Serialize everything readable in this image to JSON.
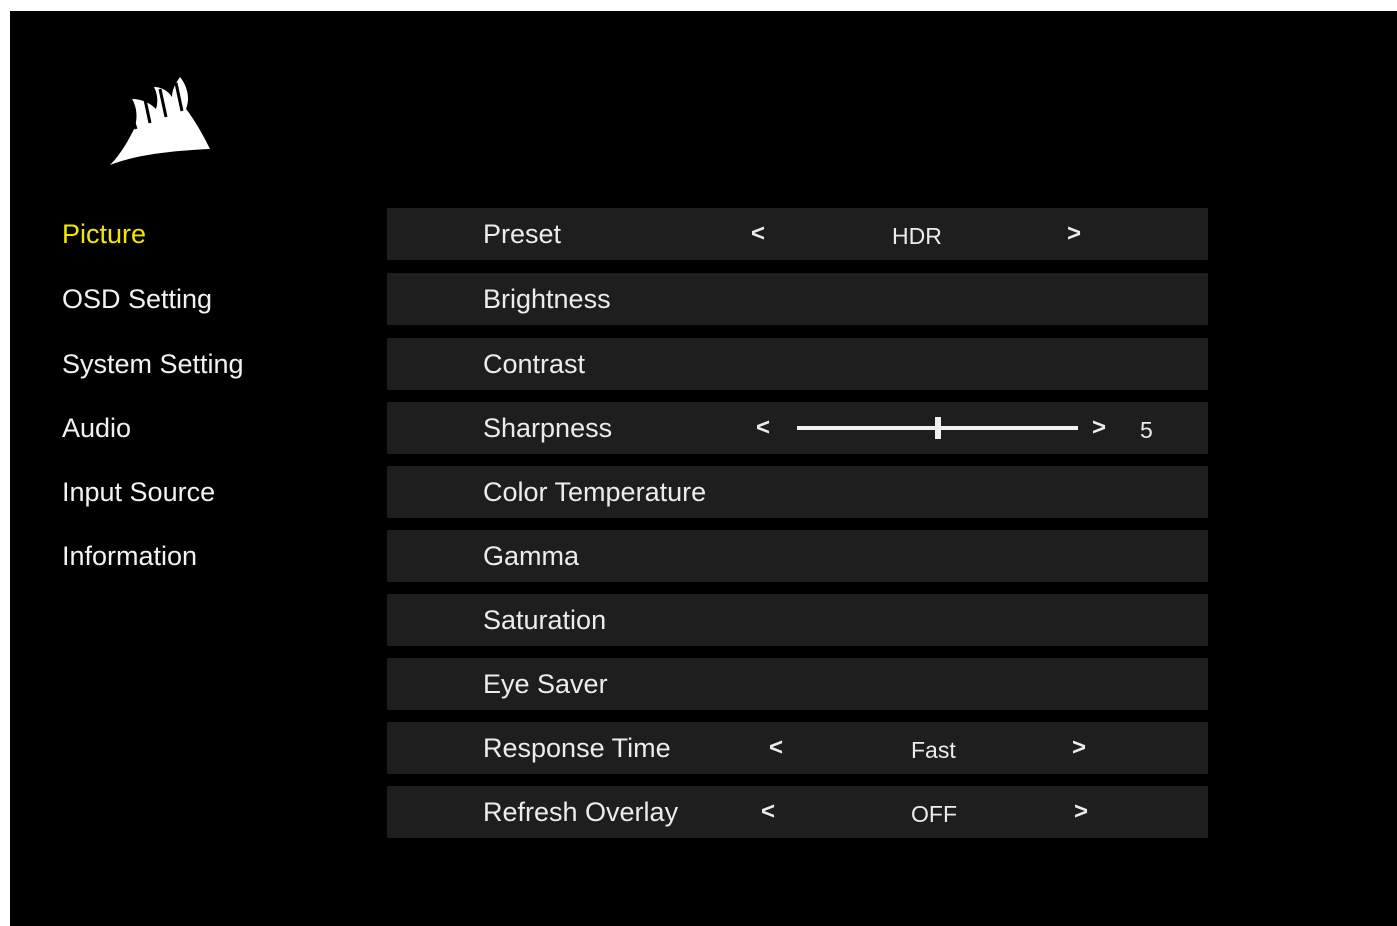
{
  "brand": {
    "logo_icon": "corsair-sails-logo",
    "accent_color": "#f2e700"
  },
  "nav": {
    "items": [
      {
        "label": "Picture",
        "active": true
      },
      {
        "label": "OSD Setting",
        "active": false
      },
      {
        "label": "System Setting",
        "active": false
      },
      {
        "label": "Audio",
        "active": false
      },
      {
        "label": "Input Source",
        "active": false
      },
      {
        "label": "Information",
        "active": false
      }
    ]
  },
  "picture_menu": {
    "preset": {
      "label": "Preset",
      "left_arrow": "<",
      "value": "HDR",
      "right_arrow": ">"
    },
    "brightness": {
      "label": "Brightness"
    },
    "contrast": {
      "label": "Contrast"
    },
    "sharpness": {
      "label": "Sharpness",
      "left_arrow": "<",
      "right_arrow": ">",
      "value": "5",
      "slider_fraction": 0.5
    },
    "color_temperature": {
      "label": "Color Temperature"
    },
    "gamma": {
      "label": "Gamma"
    },
    "saturation": {
      "label": "Saturation"
    },
    "eye_saver": {
      "label": "Eye Saver"
    },
    "response_time": {
      "label": "Response Time",
      "left_arrow": "<",
      "value": "Fast",
      "right_arrow": ">"
    },
    "refresh_overlay": {
      "label": "Refresh Overlay",
      "left_arrow": "<",
      "value": "OFF",
      "right_arrow": ">"
    }
  }
}
